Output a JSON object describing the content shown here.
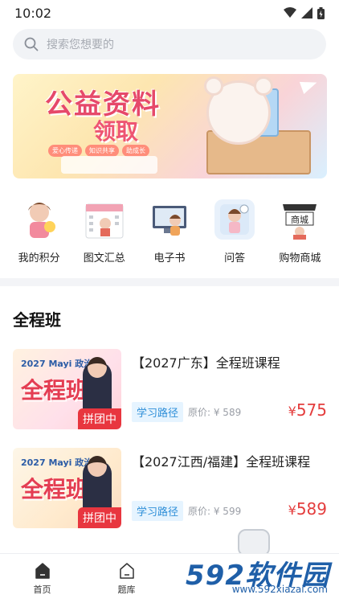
{
  "status": {
    "time": "10:02"
  },
  "search": {
    "placeholder": "搜索您想要的"
  },
  "banner": {
    "title": "公益资料",
    "subtitle": "领取",
    "tags": [
      "爱心传递",
      "知识共享",
      "助成长"
    ]
  },
  "shortcuts": [
    {
      "label": "我的积分"
    },
    {
      "label": "图文汇总"
    },
    {
      "label": "电子书"
    },
    {
      "label": "问答"
    },
    {
      "label": "购物商城"
    }
  ],
  "section": {
    "title": "全程班"
  },
  "courses": [
    {
      "thumb_year": "2027 Mayi 政治",
      "thumb_text": "全程班",
      "badge": "拼团中",
      "title": "【2027广东】全程班课程",
      "tag": "学习路径",
      "original_price": "原价: ¥ 589",
      "currency": "¥",
      "price": "575"
    },
    {
      "thumb_year": "2027 Mayi 政治",
      "thumb_text": "全程班",
      "badge": "拼团中",
      "title": "【2027江西/福建】全程班课程",
      "tag": "学习路径",
      "original_price": "原价: ¥ 599",
      "currency": "¥",
      "price": "589"
    }
  ],
  "nav": [
    {
      "label": "首页",
      "icon": "home-icon"
    },
    {
      "label": "题库",
      "icon": "question-bank-icon"
    }
  ],
  "watermark": {
    "big": "592软件园",
    "small": "www.592xiazai.com"
  },
  "colors": {
    "price": "#e43d3d",
    "accent_blue": "#2f8fd8",
    "badge_red": "#e8363f"
  }
}
